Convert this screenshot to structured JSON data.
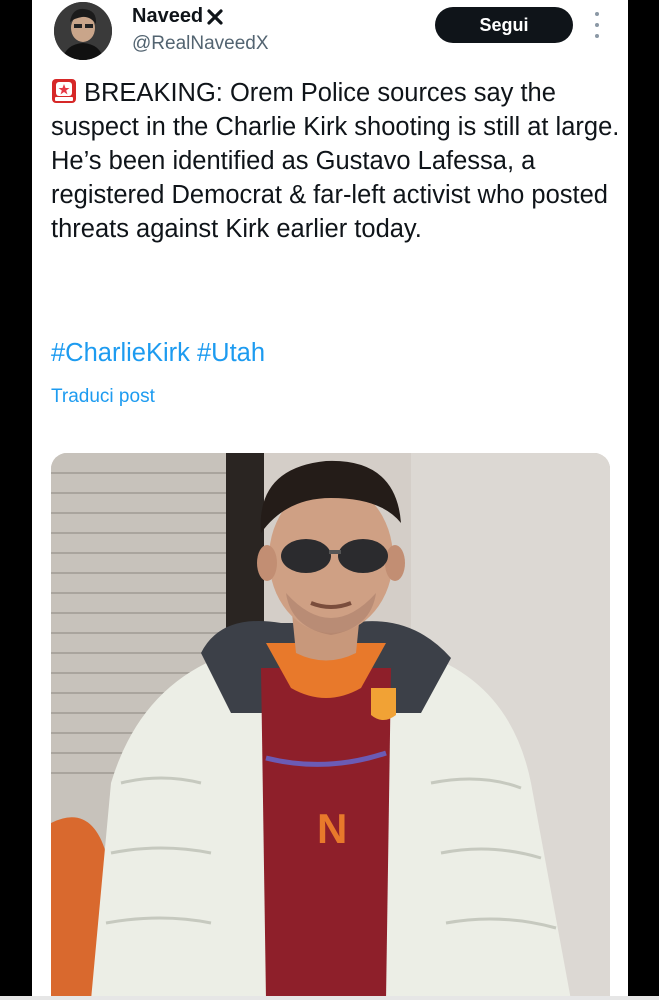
{
  "post": {
    "author_name": "Naveed",
    "author_handle": "@RealNaveedX",
    "follow_label": "Segui",
    "text": "BREAKING: Orem Police sources say the suspect in the Charlie Kirk shooting is still at large. He’s been identified as Gustavo Lafessa, a registered Democrat & far-left activist who posted threats against Kirk earlier today.",
    "hashtags": [
      "#CharlieKirk",
      "#Utah"
    ],
    "translate_label": "Traduci post"
  },
  "icons": {
    "verified": "x-mark-icon",
    "siren": "police-light-emoji-icon",
    "more": "more-vertical-icon"
  },
  "colors": {
    "link": "#1d9bf0",
    "text": "#0f1419",
    "secondary": "#536471",
    "button_bg": "#0f1419"
  }
}
